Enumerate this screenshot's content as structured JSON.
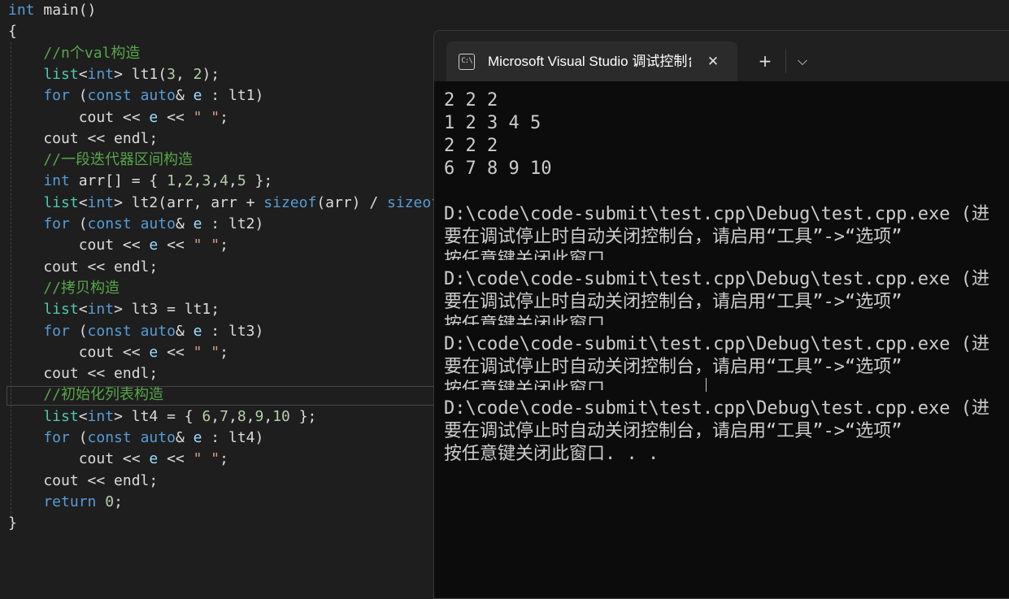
{
  "editor": {
    "lines": [
      {
        "segments": [
          {
            "t": "int",
            "c": "kw"
          },
          {
            "t": " main()",
            "c": "pl"
          }
        ]
      },
      {
        "segments": [
          {
            "t": "{",
            "c": "pl"
          }
        ]
      },
      {
        "segments": [
          {
            "t": "    //n个val构造",
            "c": "cm"
          }
        ]
      },
      {
        "segments": [
          {
            "t": "    list",
            "c": "ty"
          },
          {
            "t": "<",
            "c": "pl"
          },
          {
            "t": "int",
            "c": "kw"
          },
          {
            "t": "> lt1(",
            "c": "pl"
          },
          {
            "t": "3",
            "c": "num"
          },
          {
            "t": ", ",
            "c": "pl"
          },
          {
            "t": "2",
            "c": "num"
          },
          {
            "t": ");",
            "c": "pl"
          }
        ]
      },
      {
        "segments": [
          {
            "t": "    for",
            "c": "kw"
          },
          {
            "t": " (",
            "c": "pl"
          },
          {
            "t": "const",
            "c": "kw"
          },
          {
            "t": " ",
            "c": "pl"
          },
          {
            "t": "auto",
            "c": "kw"
          },
          {
            "t": "& ",
            "c": "pl"
          },
          {
            "t": "e",
            "c": "var"
          },
          {
            "t": " : lt1)",
            "c": "pl"
          }
        ]
      },
      {
        "segments": [
          {
            "t": "        cout << ",
            "c": "pl"
          },
          {
            "t": "e",
            "c": "var"
          },
          {
            "t": " << ",
            "c": "pl"
          },
          {
            "t": "\" \"",
            "c": "str"
          },
          {
            "t": ";",
            "c": "pl"
          }
        ]
      },
      {
        "segments": [
          {
            "t": "    cout << endl;",
            "c": "pl"
          }
        ]
      },
      {
        "segments": [
          {
            "t": "    //一段迭代器区间构造",
            "c": "cm"
          }
        ]
      },
      {
        "segments": [
          {
            "t": "    int",
            "c": "kw"
          },
          {
            "t": " arr[] = { ",
            "c": "pl"
          },
          {
            "t": "1",
            "c": "num"
          },
          {
            "t": ",",
            "c": "pl"
          },
          {
            "t": "2",
            "c": "num"
          },
          {
            "t": ",",
            "c": "pl"
          },
          {
            "t": "3",
            "c": "num"
          },
          {
            "t": ",",
            "c": "pl"
          },
          {
            "t": "4",
            "c": "num"
          },
          {
            "t": ",",
            "c": "pl"
          },
          {
            "t": "5",
            "c": "num"
          },
          {
            "t": " };",
            "c": "pl"
          }
        ]
      },
      {
        "segments": [
          {
            "t": "    list",
            "c": "ty"
          },
          {
            "t": "<",
            "c": "pl"
          },
          {
            "t": "int",
            "c": "kw"
          },
          {
            "t": "> lt2(arr, arr + ",
            "c": "pl"
          },
          {
            "t": "sizeof",
            "c": "kw"
          },
          {
            "t": "(arr) / ",
            "c": "pl"
          },
          {
            "t": "sizeof",
            "c": "kw"
          }
        ]
      },
      {
        "segments": [
          {
            "t": "    for",
            "c": "kw"
          },
          {
            "t": " (",
            "c": "pl"
          },
          {
            "t": "const",
            "c": "kw"
          },
          {
            "t": " ",
            "c": "pl"
          },
          {
            "t": "auto",
            "c": "kw"
          },
          {
            "t": "& ",
            "c": "pl"
          },
          {
            "t": "e",
            "c": "var"
          },
          {
            "t": " : lt2)",
            "c": "pl"
          }
        ]
      },
      {
        "segments": [
          {
            "t": "        cout << ",
            "c": "pl"
          },
          {
            "t": "e",
            "c": "var"
          },
          {
            "t": " << ",
            "c": "pl"
          },
          {
            "t": "\" \"",
            "c": "str"
          },
          {
            "t": ";",
            "c": "pl"
          }
        ]
      },
      {
        "segments": [
          {
            "t": "    cout << endl;",
            "c": "pl"
          }
        ]
      },
      {
        "segments": [
          {
            "t": "    //拷贝构造",
            "c": "cm"
          }
        ]
      },
      {
        "segments": [
          {
            "t": "    list",
            "c": "ty"
          },
          {
            "t": "<",
            "c": "pl"
          },
          {
            "t": "int",
            "c": "kw"
          },
          {
            "t": "> lt3 = lt1;",
            "c": "pl"
          }
        ]
      },
      {
        "segments": [
          {
            "t": "    for",
            "c": "kw"
          },
          {
            "t": " (",
            "c": "pl"
          },
          {
            "t": "const",
            "c": "kw"
          },
          {
            "t": " ",
            "c": "pl"
          },
          {
            "t": "auto",
            "c": "kw"
          },
          {
            "t": "& ",
            "c": "pl"
          },
          {
            "t": "e",
            "c": "var"
          },
          {
            "t": " : lt3)",
            "c": "pl"
          }
        ]
      },
      {
        "segments": [
          {
            "t": "        cout << ",
            "c": "pl"
          },
          {
            "t": "e",
            "c": "var"
          },
          {
            "t": " << ",
            "c": "pl"
          },
          {
            "t": "\" \"",
            "c": "str"
          },
          {
            "t": ";",
            "c": "pl"
          }
        ]
      },
      {
        "segments": [
          {
            "t": "    cout << endl;",
            "c": "pl"
          }
        ]
      },
      {
        "segments": [
          {
            "t": "    //初始化列表构造",
            "c": "cm"
          }
        ]
      },
      {
        "segments": [
          {
            "t": "    list",
            "c": "ty"
          },
          {
            "t": "<",
            "c": "pl"
          },
          {
            "t": "int",
            "c": "kw"
          },
          {
            "t": "> lt4 = { ",
            "c": "pl"
          },
          {
            "t": "6",
            "c": "num"
          },
          {
            "t": ",",
            "c": "pl"
          },
          {
            "t": "7",
            "c": "num"
          },
          {
            "t": ",",
            "c": "pl"
          },
          {
            "t": "8",
            "c": "num"
          },
          {
            "t": ",",
            "c": "pl"
          },
          {
            "t": "9",
            "c": "num"
          },
          {
            "t": ",",
            "c": "pl"
          },
          {
            "t": "10",
            "c": "num"
          },
          {
            "t": " };",
            "c": "pl"
          }
        ]
      },
      {
        "segments": [
          {
            "t": "    for",
            "c": "kw"
          },
          {
            "t": " (",
            "c": "pl"
          },
          {
            "t": "const",
            "c": "kw"
          },
          {
            "t": " ",
            "c": "pl"
          },
          {
            "t": "auto",
            "c": "kw"
          },
          {
            "t": "& ",
            "c": "pl"
          },
          {
            "t": "e",
            "c": "var"
          },
          {
            "t": " : lt4)",
            "c": "pl"
          }
        ]
      },
      {
        "segments": [
          {
            "t": "        cout << ",
            "c": "pl"
          },
          {
            "t": "e",
            "c": "var"
          },
          {
            "t": " << ",
            "c": "pl"
          },
          {
            "t": "\" \"",
            "c": "str"
          },
          {
            "t": ";",
            "c": "pl"
          }
        ]
      },
      {
        "segments": [
          {
            "t": "    cout << endl;",
            "c": "pl"
          }
        ]
      },
      {
        "segments": [
          {
            "t": "    return",
            "c": "kw"
          },
          {
            "t": " ",
            "c": "pl"
          },
          {
            "t": "0",
            "c": "num"
          },
          {
            "t": ";",
            "c": "pl"
          }
        ]
      },
      {
        "segments": [
          {
            "t": "}",
            "c": "pl"
          }
        ]
      }
    ]
  },
  "terminal": {
    "tab_icon": "console-icon",
    "tab_icon_glyph": "C:\\",
    "tab_title": "Microsoft Visual Studio 调试控制台",
    "close_glyph": "✕",
    "new_tab_glyph": "+",
    "dropdown_glyph": "⌵",
    "output": [
      "2 2 2",
      "1 2 3 4 5",
      "2 2 2",
      "6 7 8 9 10",
      "",
      "D:\\code\\code-submit\\test.cpp\\Debug\\test.cpp.exe (进",
      "要在调试停止时自动关闭控制台，请启用“工具”->“选项”",
      "按任意键关闭此窗口. . .",
      "D:\\code\\code-submit\\test.cpp\\Debug\\test.cpp.exe (进",
      "要在调试停止时自动关闭控制台，请启用“工具”->“选项”",
      "按任意键关闭此窗口. . .",
      "D:\\code\\code-submit\\test.cpp\\Debug\\test.cpp.exe (进",
      "要在调试停止时自动关闭控制台，请启用“工具”->“选项”",
      "按任意键关闭此窗口. . .",
      "D:\\code\\code-submit\\test.cpp\\Debug\\test.cpp.exe (进",
      "要在调试停止时自动关闭控制台，请启用“工具”->“选项”",
      "按任意键关闭此窗口. . ."
    ]
  }
}
